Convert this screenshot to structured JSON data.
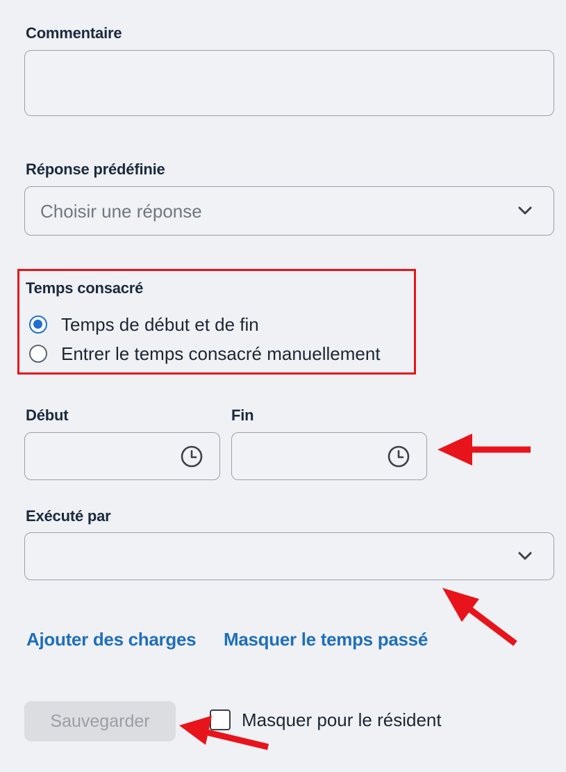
{
  "comment": {
    "label": "Commentaire",
    "value": ""
  },
  "predefined_response": {
    "label": "Réponse prédéfinie",
    "placeholder": "Choisir une réponse"
  },
  "time_spent": {
    "label": "Temps consacré",
    "options": [
      {
        "label": "Temps de début et de fin",
        "selected": true
      },
      {
        "label": "Entrer le temps consacré manuellement",
        "selected": false
      }
    ]
  },
  "start": {
    "label": "Début",
    "value": ""
  },
  "end": {
    "label": "Fin",
    "value": ""
  },
  "executed_by": {
    "label": "Exécuté par",
    "value": ""
  },
  "links": {
    "add_charges": "Ajouter des charges",
    "hide_time": "Masquer le temps passé"
  },
  "footer": {
    "save_label": "Sauvegarder",
    "hide_resident_label": "Masquer pour le résident",
    "hide_resident_checked": false
  },
  "colors": {
    "link": "#1f6fb8",
    "radio_selected": "#1d6fd0",
    "highlight_box": "#e8141b",
    "annotation_arrow": "#e8141b"
  },
  "icons": [
    "chevron-down-icon",
    "clock-icon"
  ]
}
